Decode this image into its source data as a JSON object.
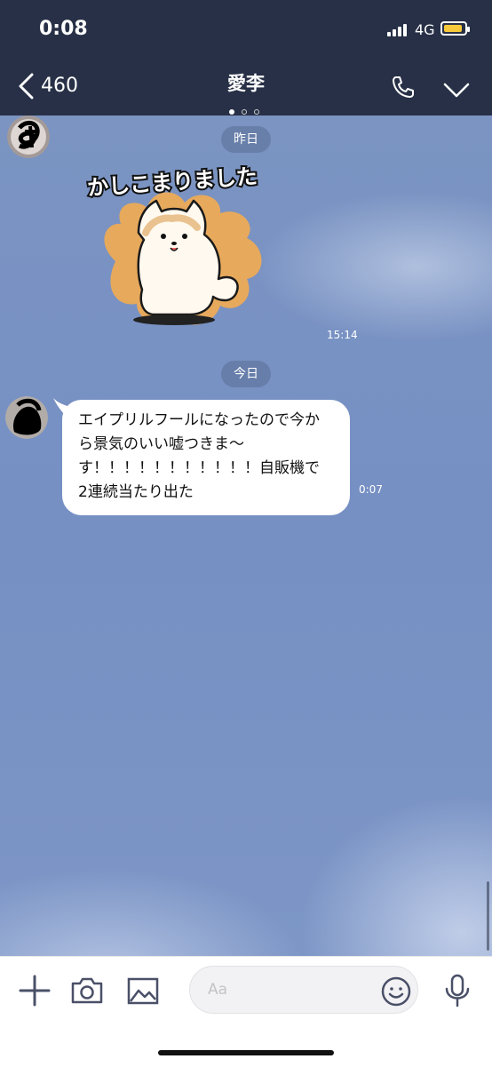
{
  "status_bar": {
    "time": "0:08",
    "network": "4G"
  },
  "header": {
    "back_count": "460",
    "title": "愛李"
  },
  "chat": {
    "date_yesterday": "昨日",
    "sticker_caption": "かしこまりました",
    "sticker_time": "15:14",
    "date_today": "今日",
    "message_lines": [
      "エイプリルフールになったので今か",
      "ら景気のいい嘘つきま〜",
      "す！！！！！！！！！！！自販機で",
      "2連続当たり出た"
    ],
    "message_time": "0:07"
  },
  "input": {
    "placeholder": "Aa"
  },
  "colors": {
    "header_bg": "#273046",
    "chat_bg": "#7690c4",
    "battery": "#f7c93a"
  }
}
